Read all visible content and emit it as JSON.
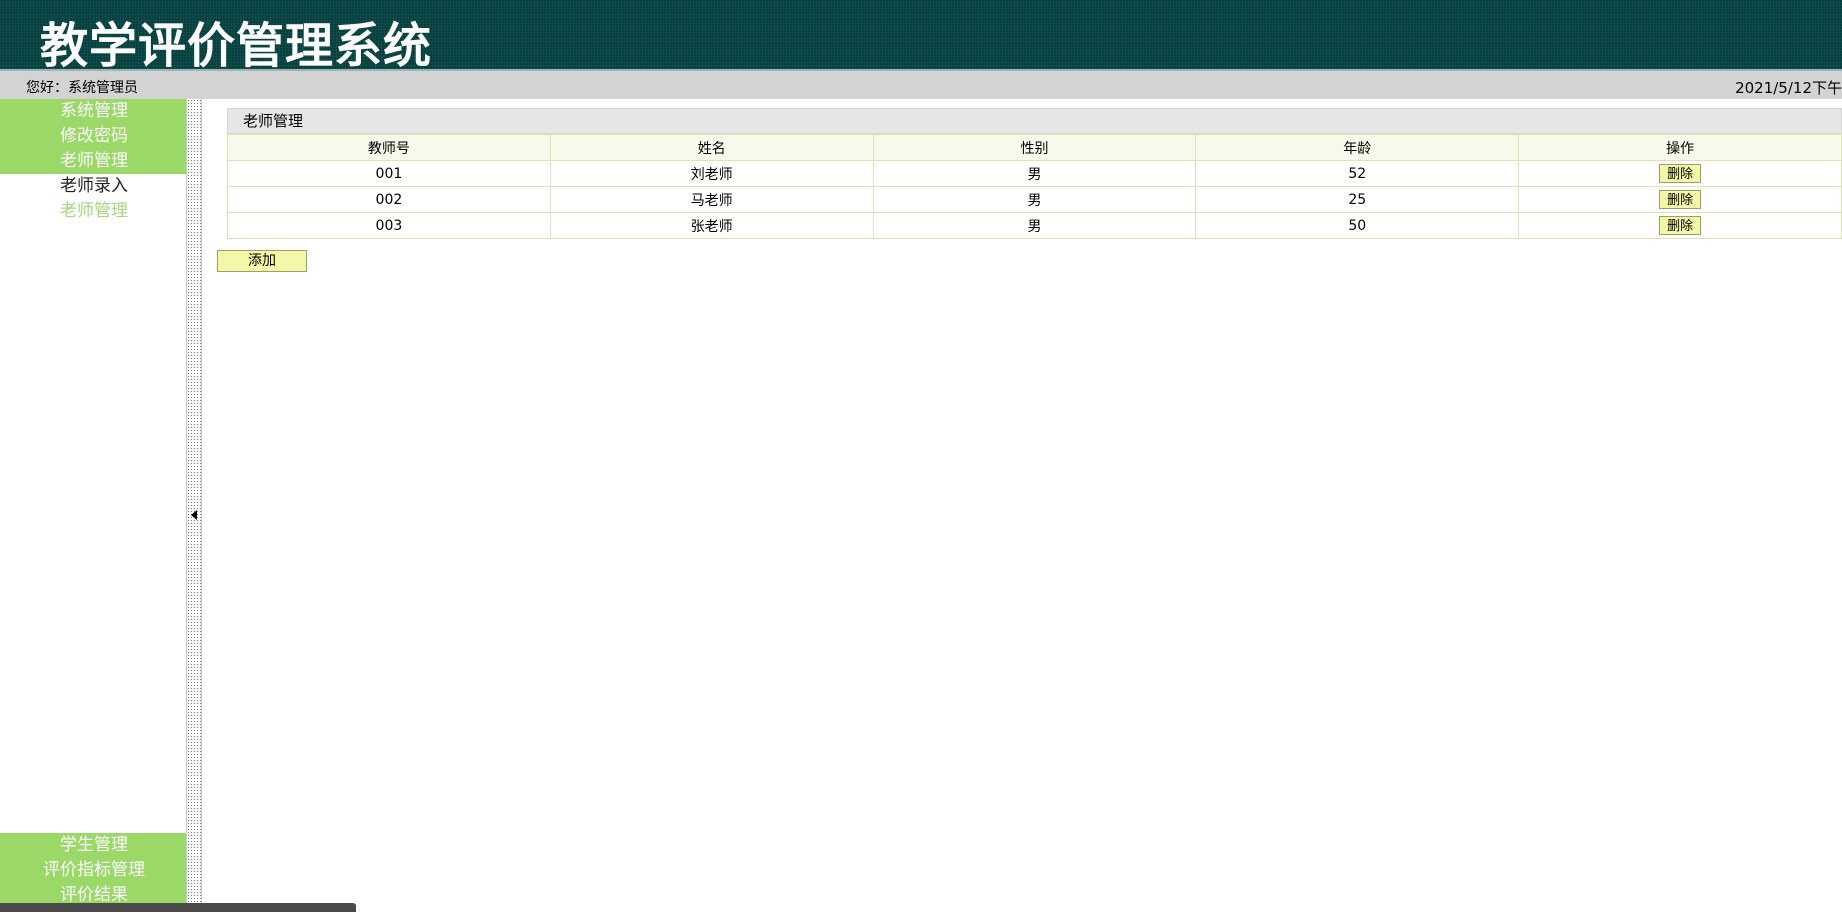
{
  "header": {
    "title": "教学评价管理系统"
  },
  "userbar": {
    "greeting": "您好：系统管理员",
    "datetime": "2021/5/12下午"
  },
  "sidebar": {
    "top_items": [
      {
        "label": "系统管理"
      },
      {
        "label": "修改密码"
      },
      {
        "label": "老师管理"
      }
    ],
    "sub_items": [
      {
        "label": "老师录入"
      },
      {
        "label": "老师管理"
      }
    ],
    "bottom_items": [
      {
        "label": "学生管理"
      },
      {
        "label": "评价指标管理"
      },
      {
        "label": "评价结果"
      }
    ]
  },
  "panel": {
    "title": "老师管理",
    "columns": [
      "教师号",
      "姓名",
      "性别",
      "年龄",
      "操作"
    ],
    "rows": [
      {
        "id": "001",
        "name": "刘老师",
        "gender": "男",
        "age": "52",
        "action": "删除"
      },
      {
        "id": "002",
        "name": "马老师",
        "gender": "男",
        "age": "25",
        "action": "删除"
      },
      {
        "id": "003",
        "name": "张老师",
        "gender": "男",
        "age": "50",
        "action": "删除"
      }
    ],
    "add_label": "添加"
  },
  "colors": {
    "header_bg": "#04403f",
    "menu_green": "#9ad868",
    "active_sub": "#a2d97c",
    "button_bg": "#f4f7a8"
  }
}
